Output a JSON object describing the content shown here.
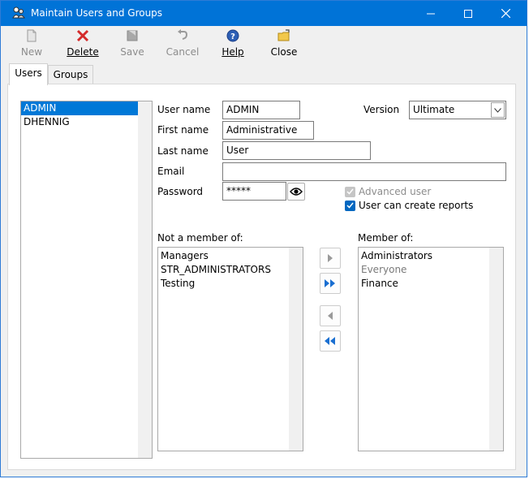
{
  "window": {
    "title": "Maintain Users and Groups"
  },
  "toolbar": {
    "new_label": "New",
    "delete_label": "Delete",
    "save_label": "Save",
    "cancel_label": "Cancel",
    "help_label": "Help",
    "close_label": "Close"
  },
  "tabs": {
    "users": "Users",
    "groups": "Groups"
  },
  "users": {
    "items": [
      "ADMIN",
      "DHENNIG"
    ],
    "selected": "ADMIN"
  },
  "form": {
    "user_name_label": "User name",
    "user_name_value": "ADMIN",
    "first_name_label": "First name",
    "first_name_value": "Administrative",
    "last_name_label": "Last name",
    "last_name_value": "User",
    "email_label": "Email",
    "email_value": "",
    "password_label": "Password",
    "password_value": "*****",
    "version_label": "Version",
    "version_value": "Ultimate",
    "advanced_user_label": "Advanced user",
    "advanced_user_checked": true,
    "can_create_reports_label": "User can create reports",
    "can_create_reports_checked": true
  },
  "membership": {
    "not_member_label": "Not a member of:",
    "not_member_items": [
      "Managers",
      "STR_ADMINISTRATORS",
      "Testing"
    ],
    "member_label": "Member of:",
    "member_items": [
      "Administrators",
      "Everyone",
      "Finance"
    ]
  },
  "colors": {
    "titlebar": "#0073d7",
    "selection": "#0078d7",
    "checkbox": "#0067c0",
    "delete_red": "#d42a2a",
    "help_blue": "#2d5fb5",
    "move_blue": "#1a6fd1"
  }
}
